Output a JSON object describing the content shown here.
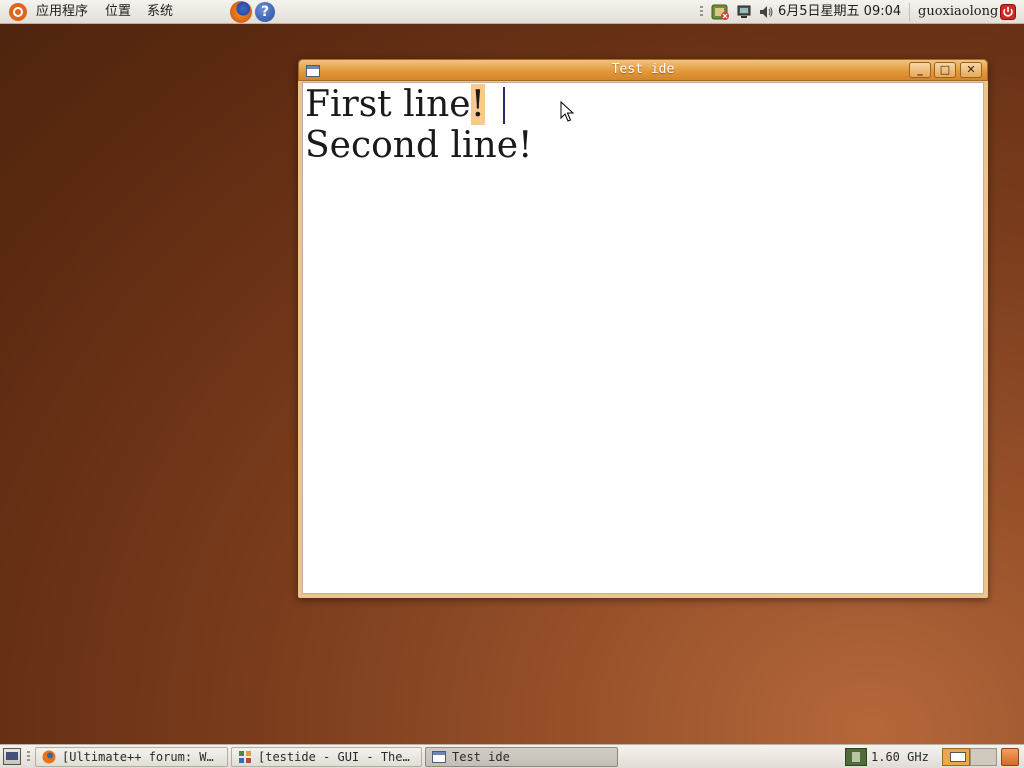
{
  "top_panel": {
    "menus": [
      "应用程序",
      "位置",
      "系统"
    ],
    "clock": "6月5日星期五 09:04",
    "user": "guoxiaolong"
  },
  "window": {
    "title": "Test ide",
    "lines": [
      "First line",
      "!",
      "Second line!"
    ],
    "buttons": {
      "minimize": "_",
      "maximize": "□",
      "close": "✕"
    }
  },
  "taskbar": {
    "tasks": [
      {
        "label": "[Ultimate++ forum: W…"
      },
      {
        "label": "[testide - GUI - The…"
      },
      {
        "label": "Test ide"
      }
    ],
    "cpu_freq": "1.60 GHz"
  },
  "colors": {
    "titlebar": "#e39a3a",
    "selection": "#f9c990",
    "desktop": "#7a3c1c"
  }
}
